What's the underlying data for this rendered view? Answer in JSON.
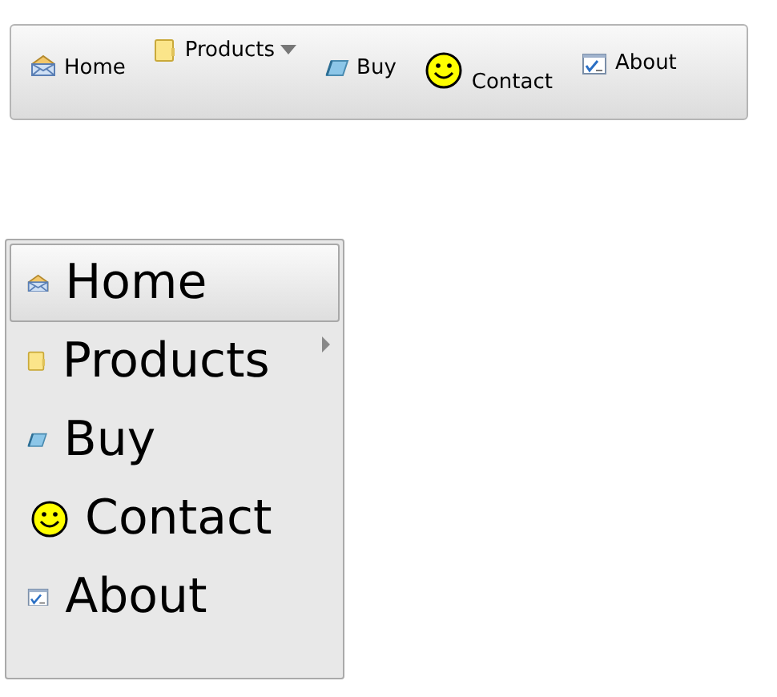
{
  "menus": [
    {
      "kind": "bar",
      "items": [
        {
          "label": "Home",
          "kind": "envelope",
          "submenu": false,
          "selected": false
        },
        {
          "label": "Products",
          "kind": "folder",
          "submenu": true,
          "selected": false
        },
        {
          "label": "Buy",
          "kind": "eraser",
          "submenu": false,
          "selected": false
        },
        {
          "label": "Contact",
          "kind": "smiley",
          "submenu": false,
          "selected": false
        },
        {
          "label": "About",
          "kind": "checkwindow",
          "submenu": false,
          "selected": false
        }
      ]
    },
    {
      "kind": "panel",
      "items": [
        {
          "label": "Home",
          "kind": "envelope",
          "submenu": false,
          "selected": true
        },
        {
          "label": "Products",
          "kind": "folder",
          "submenu": true,
          "selected": false
        },
        {
          "label": "Buy",
          "kind": "eraser",
          "submenu": false,
          "selected": false
        },
        {
          "label": "Contact",
          "kind": "smiley",
          "submenu": false,
          "selected": false
        },
        {
          "label": "About",
          "kind": "checkwindow",
          "submenu": false,
          "selected": false
        }
      ]
    }
  ]
}
